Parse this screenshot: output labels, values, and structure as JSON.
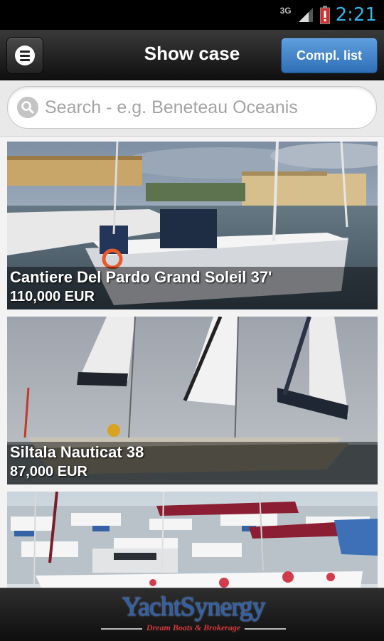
{
  "status_bar": {
    "network": "3G",
    "time": "2:21"
  },
  "header": {
    "title": "Show case",
    "compl_list_label": "Compl. list"
  },
  "search": {
    "placeholder": "Search - e.g. Beneteau Oceanis",
    "value": ""
  },
  "listings": [
    {
      "name": "Cantiere Del Pardo Grand Soleil 37'",
      "price": "110,000 EUR"
    },
    {
      "name": "Siltala Nauticat 38",
      "price": "87,000 EUR"
    },
    {
      "name": "",
      "price": ""
    }
  ],
  "footer": {
    "logo_text": "YachtSynergy",
    "logo_tagline": "Dream Boats & Brokerage"
  },
  "colors": {
    "accent_blue": "#3b7fc4",
    "status_time": "#33b5e5",
    "battery_red": "#d32f2f",
    "logo_blue": "#2e5fa8",
    "logo_red": "#d53a3a"
  },
  "icons": {
    "menu": "menu-icon",
    "search": "search-icon",
    "signal": "signal-icon",
    "battery": "battery-icon"
  }
}
